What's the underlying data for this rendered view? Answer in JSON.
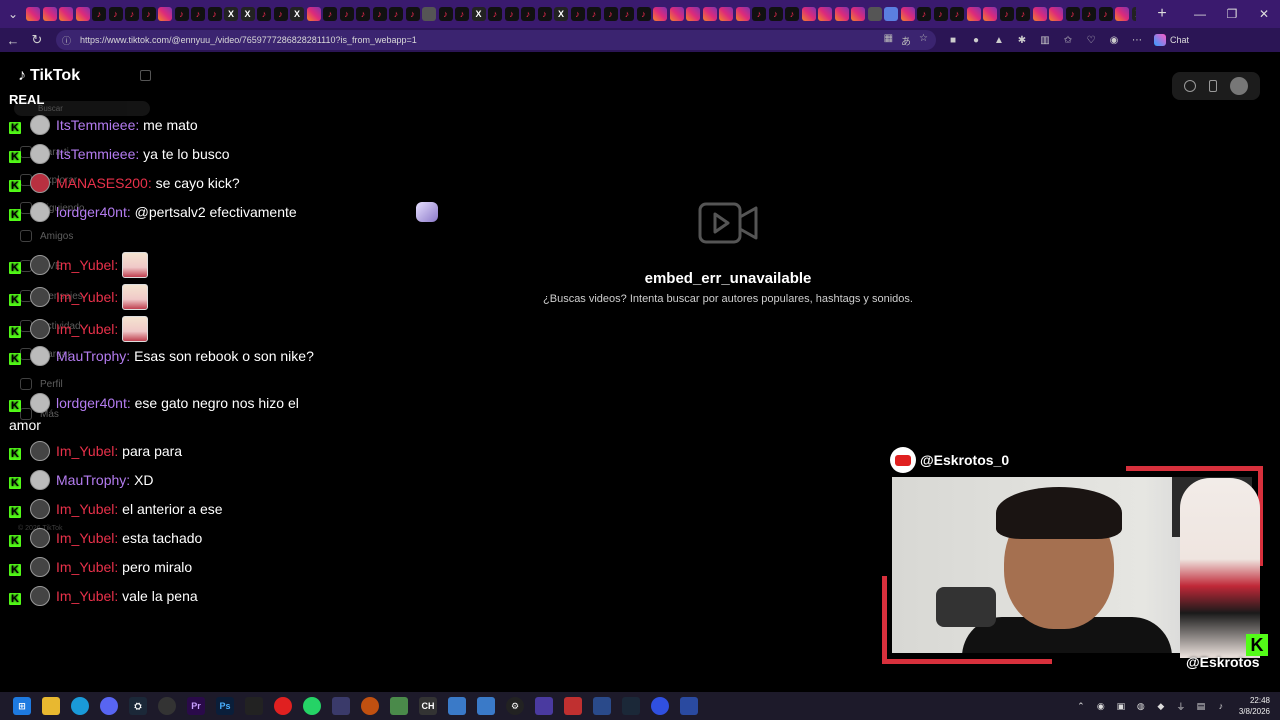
{
  "browser": {
    "url": "https://www.tiktok.com/@ennyuu_/video/7659777286828281110?is_from_webapp=1",
    "chat_label": "Chat",
    "tab_icons": [
      "ig",
      "ig",
      "ig",
      "ig",
      "tt",
      "tt",
      "tt",
      "tt",
      "ig",
      "tt",
      "tt",
      "tt",
      "x",
      "x",
      "tt",
      "tt",
      "x",
      "ig",
      "tt",
      "tt",
      "tt",
      "tt",
      "tt",
      "tt",
      "gr",
      "tt",
      "tt",
      "x",
      "tt",
      "tt",
      "tt",
      "tt",
      "x",
      "tt",
      "tt",
      "tt",
      "tt",
      "tt",
      "ig",
      "ig",
      "ig",
      "ig",
      "ig",
      "ig",
      "tt",
      "tt",
      "tt",
      "ig",
      "ig",
      "ig",
      "ig",
      "gr",
      "ac",
      "ig",
      "tt",
      "tt",
      "tt",
      "ig",
      "ig",
      "tt",
      "tt",
      "ig",
      "ig",
      "tt",
      "tt",
      "tt",
      "ig",
      "x",
      "x",
      "tt",
      "tt",
      "ig",
      "ig",
      "tt",
      "tt",
      "ig",
      "gr",
      "ig",
      "ig",
      "tt",
      "tt",
      "tt",
      "ig",
      "ig",
      "tt",
      "tt",
      "tt",
      "tt",
      "tt",
      "tt",
      "tt",
      "tt",
      "tt",
      "tt"
    ]
  },
  "tiktok": {
    "logo": "TikTok",
    "search_placeholder": "Buscar",
    "nav": [
      {
        "label": "Para ti"
      },
      {
        "label": "Explorar"
      },
      {
        "label": "Siguiendo"
      },
      {
        "label": "Amigos"
      },
      {
        "label": "LIVE"
      },
      {
        "label": "Mensajes"
      },
      {
        "label": "Actividad"
      },
      {
        "label": "Cargar"
      },
      {
        "label": "Perfil"
      },
      {
        "label": "Más"
      }
    ],
    "copyright": "© 2026 TikTok"
  },
  "chat": {
    "header": "REAL",
    "messages": [
      {
        "user": "ItsTemmieee:",
        "text": "me mato",
        "color": "purple"
      },
      {
        "user": "ItsTemmieee:",
        "text": "ya te lo busco",
        "color": "purple"
      },
      {
        "user": "MANASES200:",
        "text": "se cayo kick?",
        "color": "red"
      },
      {
        "user": "lordger40nt:",
        "text": "@pertsalv2 efectivamente",
        "color": "purple"
      },
      {
        "user": "Im_Yubel:",
        "text": "",
        "color": "red",
        "emote": true
      },
      {
        "user": "Im_Yubel:",
        "text": "",
        "color": "red",
        "emote": true
      },
      {
        "user": "Im_Yubel:",
        "text": "",
        "color": "red",
        "emote": true
      },
      {
        "user": "MauTrophy:",
        "text": "Esas son rebook o son nike?",
        "color": "purple"
      },
      {
        "user": "lordger40nt:",
        "text": "ese gato negro nos hizo el amor",
        "color": "purple"
      },
      {
        "user": "Im_Yubel:",
        "text": "para para",
        "color": "red"
      },
      {
        "user": "MauTrophy:",
        "text": "XD",
        "color": "purple"
      },
      {
        "user": "Im_Yubel:",
        "text": "el anterior a ese",
        "color": "red"
      },
      {
        "user": "Im_Yubel:",
        "text": "esta tachado",
        "color": "red"
      },
      {
        "user": "Im_Yubel:",
        "text": "pero miralo",
        "color": "red"
      },
      {
        "user": "Im_Yubel:",
        "text": "vale la pena",
        "color": "red"
      }
    ]
  },
  "embed": {
    "title": "embed_err_unavailable",
    "subtitle": "¿Buscas videos? Intenta buscar por autores populares, hashtags y sonidos."
  },
  "webcam": {
    "tag": "@Eskrotos_0",
    "handle": "@Eskrotos",
    "kick_letter": "K"
  },
  "taskbar": {
    "time": "22:48",
    "date": "3/8/2026"
  },
  "colors": {
    "kick_green": "#53fc18",
    "purple_user": "#b47cf0",
    "red_user": "#e8314a",
    "browser_frame": "#3a1a6e"
  }
}
